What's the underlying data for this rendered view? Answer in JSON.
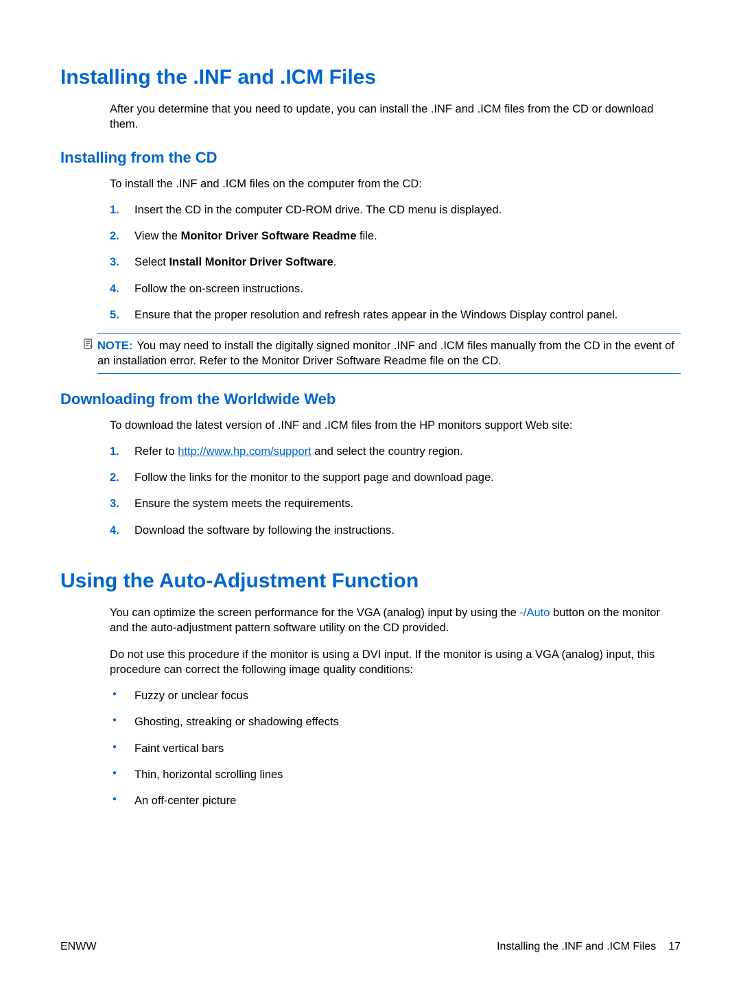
{
  "section1": {
    "heading": "Installing the .INF and .ICM Files",
    "intro": "After you determine that you need to update, you can install the .INF and .ICM files from the CD or download them.",
    "sub1": {
      "heading": "Installing from the CD",
      "intro": "To install the .INF and .ICM files on the computer from the CD:",
      "steps": {
        "s1": {
          "num": "1.",
          "text": "Insert the CD in the computer CD-ROM drive. The CD menu is displayed."
        },
        "s2": {
          "num": "2.",
          "pre": "View the ",
          "bold": "Monitor Driver Software Readme",
          "post": " file."
        },
        "s3": {
          "num": "3.",
          "pre": "Select ",
          "bold": "Install Monitor Driver Software",
          "post": "."
        },
        "s4": {
          "num": "4.",
          "text": "Follow the on-screen instructions."
        },
        "s5": {
          "num": "5.",
          "text": "Ensure that the proper resolution and refresh rates appear in the Windows Display control panel."
        }
      },
      "note": {
        "label": "NOTE:",
        "text": "You may need to install the digitally signed monitor .INF and .ICM files manually from the CD in the event of an installation error. Refer to the Monitor Driver Software Readme file on the CD."
      }
    },
    "sub2": {
      "heading": "Downloading from the Worldwide Web",
      "intro": "To download the latest version of .INF and .ICM files from the HP monitors support Web site:",
      "steps": {
        "s1": {
          "num": "1.",
          "pre": "Refer to ",
          "link": "http://www.hp.com/support",
          "post": " and select the country region."
        },
        "s2": {
          "num": "2.",
          "text": "Follow the links for the monitor to the support page and download page."
        },
        "s3": {
          "num": "3.",
          "text": "Ensure the system meets the requirements."
        },
        "s4": {
          "num": "4.",
          "text": "Download the software by following the instructions."
        }
      }
    }
  },
  "section2": {
    "heading": "Using the Auto-Adjustment Function",
    "p1": {
      "pre": "You can optimize the screen performance for the VGA (analog) input by using the ",
      "accent": "-/Auto",
      "post": " button on the monitor and the auto-adjustment pattern software utility on the CD provided."
    },
    "p2": "Do not use this procedure if the monitor is using a DVI input. If the monitor is using a VGA (analog) input, this procedure can correct the following image quality conditions:",
    "bullets": {
      "b1": "Fuzzy or unclear focus",
      "b2": "Ghosting, streaking or shadowing effects",
      "b3": "Faint vertical bars",
      "b4": "Thin, horizontal scrolling lines",
      "b5": "An off-center picture"
    }
  },
  "footer": {
    "left": "ENWW",
    "rightLabel": "Installing the .INF and .ICM Files",
    "pageNum": "17"
  }
}
